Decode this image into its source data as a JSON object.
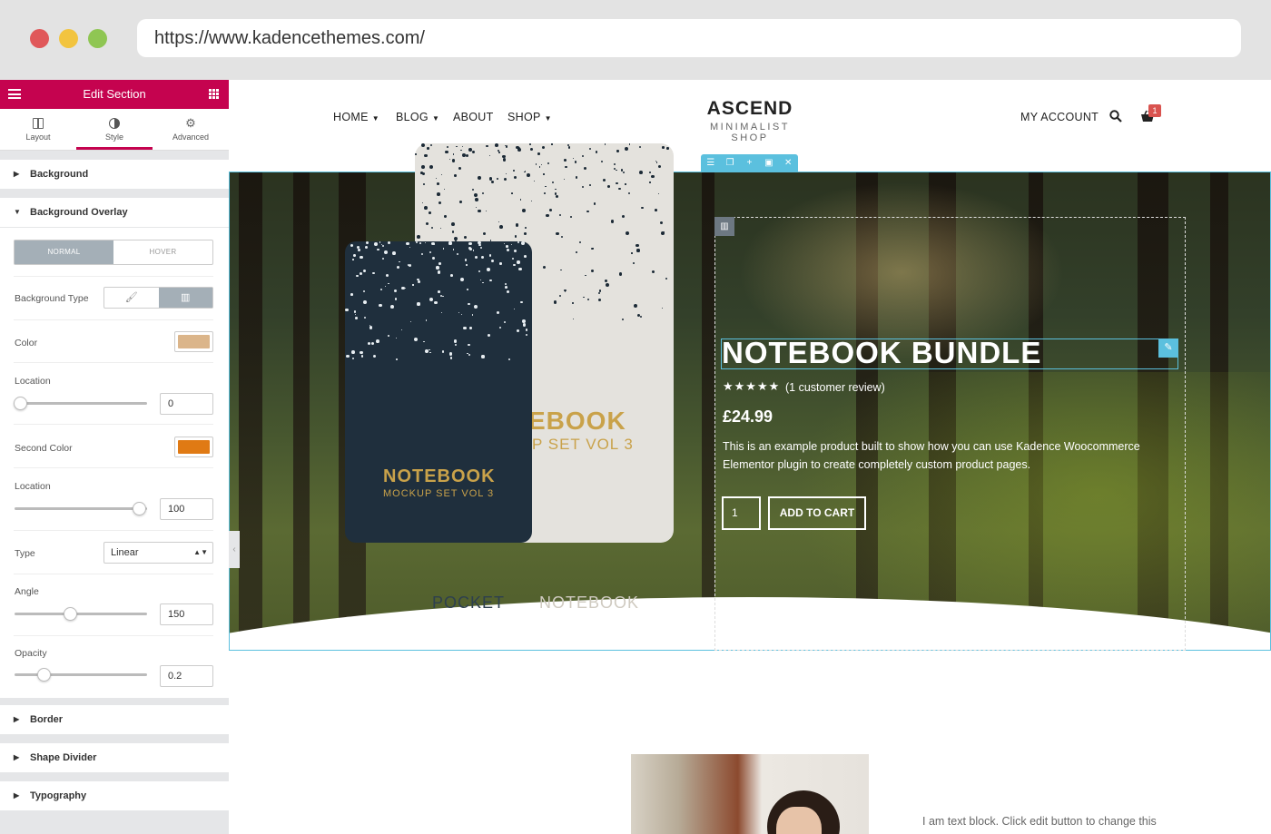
{
  "browser": {
    "url": "https://www.kadencethemes.com/"
  },
  "panel": {
    "title": "Edit Section",
    "tabs": [
      {
        "label": "Layout",
        "icon": "layout-icon"
      },
      {
        "label": "Style",
        "icon": "style-icon",
        "active": true
      },
      {
        "label": "Advanced",
        "icon": "gear-icon"
      }
    ],
    "sections": {
      "background": "Background",
      "background_overlay": "Background Overlay",
      "border": "Border",
      "shape_divider": "Shape Divider",
      "typography": "Typography"
    },
    "overlay": {
      "normal": "NORMAL",
      "hover": "HOVER",
      "background_type_label": "Background Type",
      "color_label": "Color",
      "color_value": "#dbb58a",
      "location_label": "Location",
      "location_value": "0",
      "location_fraction": 0,
      "second_color_label": "Second Color",
      "second_color_value": "#e07a14",
      "location2_label": "Location",
      "location2_value": "100",
      "location2_fraction": 1,
      "type_label": "Type",
      "type_value": "Linear",
      "angle_label": "Angle",
      "angle_value": "150",
      "angle_fraction": 0.42,
      "opacity_label": "Opacity",
      "opacity_value": "0.2",
      "opacity_fraction": 0.2
    }
  },
  "site": {
    "nav": {
      "home": "HOME",
      "blog": "BLOG",
      "about": "ABOUT",
      "shop": "SHOP",
      "account": "MY ACCOUNT"
    },
    "logo": {
      "title": "ASCEND",
      "subtitle": "MINIMALIST SHOP"
    },
    "cart_count": "1",
    "product": {
      "title": "NOTEBOOK BUNDLE",
      "stars": "★★★★★",
      "reviews": "(1 customer review)",
      "price": "£24.99",
      "description": "This is an example product built to show how you can use Kadence Woocommerce Elementor plugin to create completely custom product pages.",
      "quantity": "1",
      "add_to_cart": "ADD TO CART"
    },
    "notebook_back": {
      "line1": "EBOOK",
      "line2": "P SET VOL 3",
      "line3": "NOTEBOOK"
    },
    "notebook_front": {
      "line1": "NOTEBOOK",
      "line2": "MOCKUP SET VOL 3",
      "line3": "POCKET"
    },
    "text_block": "I am text block. Click edit button to change this"
  },
  "colors": {
    "accent": "#c5034f",
    "editor_blue": "#5bc0de"
  }
}
